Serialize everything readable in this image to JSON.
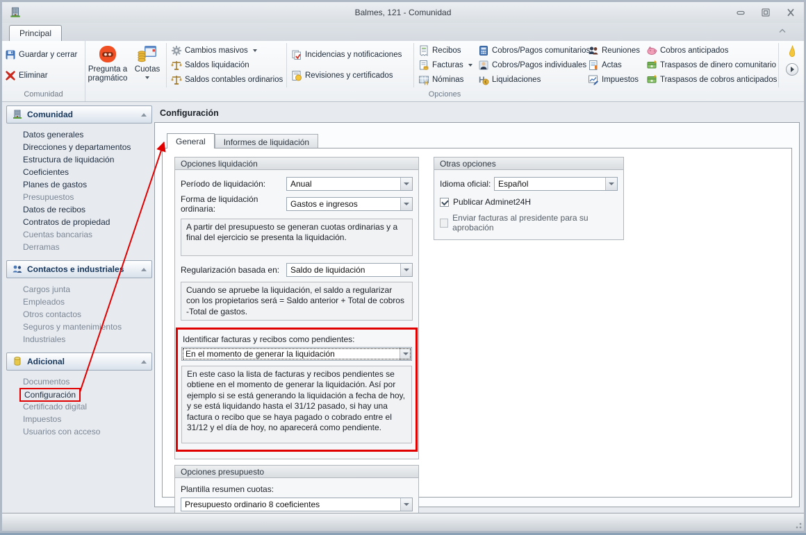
{
  "window": {
    "title": "Balmes, 121 - Comunidad"
  },
  "colors": {
    "annotation_red": "#e10000",
    "robot_orange": "#f04f23",
    "header_navy": "#16365c"
  },
  "ribbon": {
    "tab": "Principal",
    "comunidad": {
      "label": "Comunidad",
      "save": "Guardar y cerrar",
      "delete": "Eliminar"
    },
    "opciones": {
      "label": "Opciones"
    },
    "items": {
      "pregunta": "Pregunta a pragmático",
      "cuotas": "Cuotas",
      "cambios": "Cambios masivos",
      "saldos_liq": "Saldos liquidación",
      "saldos_cont": "Saldos contables ordinarios",
      "incidencias": "Incidencias y notificaciones",
      "revisiones": "Revisiones y certificados",
      "recibos": "Recibos",
      "facturas": "Facturas",
      "nominas": "Nóminas",
      "cobros_com": "Cobros/Pagos comunitarios",
      "cobros_ind": "Cobros/Pagos individuales",
      "liquidaciones": "Liquidaciones",
      "reuniones": "Reuniones",
      "actas": "Actas",
      "impuestos": "Impuestos",
      "cobros_ant": "Cobros anticipados",
      "trasp_dinero": "Traspasos de dinero comunitario",
      "trasp_cobros": "Traspasos de cobros anticipados"
    }
  },
  "sidebar": {
    "groups": [
      {
        "title": "Comunidad",
        "icon": "building-icon",
        "items": [
          {
            "label": "Datos generales",
            "muted": false
          },
          {
            "label": "Direcciones y departamentos",
            "muted": false
          },
          {
            "label": "Estructura de liquidación",
            "muted": false
          },
          {
            "label": "Coeficientes",
            "muted": false
          },
          {
            "label": "Planes de gastos",
            "muted": false
          },
          {
            "label": "Presupuestos",
            "muted": true
          },
          {
            "label": "Datos de recibos",
            "muted": false
          },
          {
            "label": "Contratos de propiedad",
            "muted": false
          },
          {
            "label": "Cuentas bancarias",
            "muted": true
          },
          {
            "label": "Derramas",
            "muted": true
          }
        ]
      },
      {
        "title": "Contactos e industriales",
        "icon": "people-icon",
        "items": [
          {
            "label": "Cargos junta",
            "muted": true
          },
          {
            "label": "Empleados",
            "muted": true
          },
          {
            "label": "Otros contactos",
            "muted": true
          },
          {
            "label": "Seguros y mantenimientos",
            "muted": true
          },
          {
            "label": "Industriales",
            "muted": true
          }
        ]
      },
      {
        "title": "Adicional",
        "icon": "database-icon",
        "items": [
          {
            "label": "Documentos",
            "muted": true
          },
          {
            "label": "Configuración",
            "muted": false,
            "selected": true
          },
          {
            "label": "Certificado digital",
            "muted": true
          },
          {
            "label": "Impuestos",
            "muted": true
          },
          {
            "label": "Usuarios con acceso",
            "muted": true
          }
        ]
      }
    ]
  },
  "main": {
    "title": "Configuración",
    "tabs": [
      {
        "label": "General",
        "active": true
      },
      {
        "label": "Informes de liquidación",
        "active": false
      }
    ],
    "liq": {
      "title": "Opciones liquidación",
      "periodo_label": "Período de liquidación:",
      "periodo_value": "Anual",
      "forma_label": "Forma de liquidación ordinaria:",
      "forma_value": "Gastos e ingresos",
      "forma_help": "A partir del presupuesto se generan cuotas ordinarias y a final del ejercicio se presenta la liquidación.",
      "reg_label": "Regularización basada en:",
      "reg_value": "Saldo de liquidación",
      "reg_help": "Cuando se apruebe la liquidación, el saldo a regularizar con los propietarios será = Saldo anterior + Total de cobros -Total de gastos.",
      "ident_label": "Identificar facturas y recibos como pendientes:",
      "ident_value": "En el momento de generar la liquidación",
      "ident_help": "En este caso la lista de facturas y recibos pendientes se obtiene en el momento de generar la liquidación. Así por ejemplo si se está generando la liquidación a fecha de hoy, y se está liquidando hasta el 31/12 pasado, si hay una factura o recibo que se haya pagado o cobrado entre el 31/12 y el día de hoy, no aparecerá como pendiente."
    },
    "pres": {
      "title": "Opciones presupuesto",
      "plantilla_label": "Plantilla resumen cuotas:",
      "plantilla_value": "Presupuesto ordinario 8 coeficientes"
    },
    "otras": {
      "title": "Otras opciones",
      "idioma_label": "Idioma oficial:",
      "idioma_value": "Español",
      "publicar_label": "Publicar Adminet24H",
      "publicar_checked": true,
      "enviar_label": "Enviar facturas al presidente para su aprobación",
      "enviar_checked": false
    }
  }
}
